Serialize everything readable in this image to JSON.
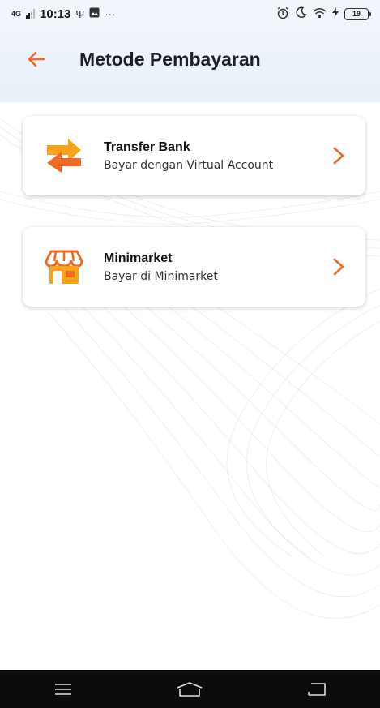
{
  "status_bar": {
    "network": "4G",
    "time": "10:13",
    "usb_symbol": "Ψ",
    "more": "···",
    "battery_level": "19"
  },
  "app_bar": {
    "title": "Metode Pembayaran"
  },
  "payment_methods": [
    {
      "title": "Transfer Bank",
      "subtitle": "Bayar dengan Virtual Account",
      "icon": "transfer-arrows-icon"
    },
    {
      "title": "Minimarket",
      "subtitle": "Bayar di Minimarket",
      "icon": "store-icon"
    }
  ],
  "colors": {
    "accent": "#f26a22",
    "accent_light": "#f7a21b",
    "header_bg": "#e8eff8",
    "navbar_bg": "#0c0c0c"
  }
}
